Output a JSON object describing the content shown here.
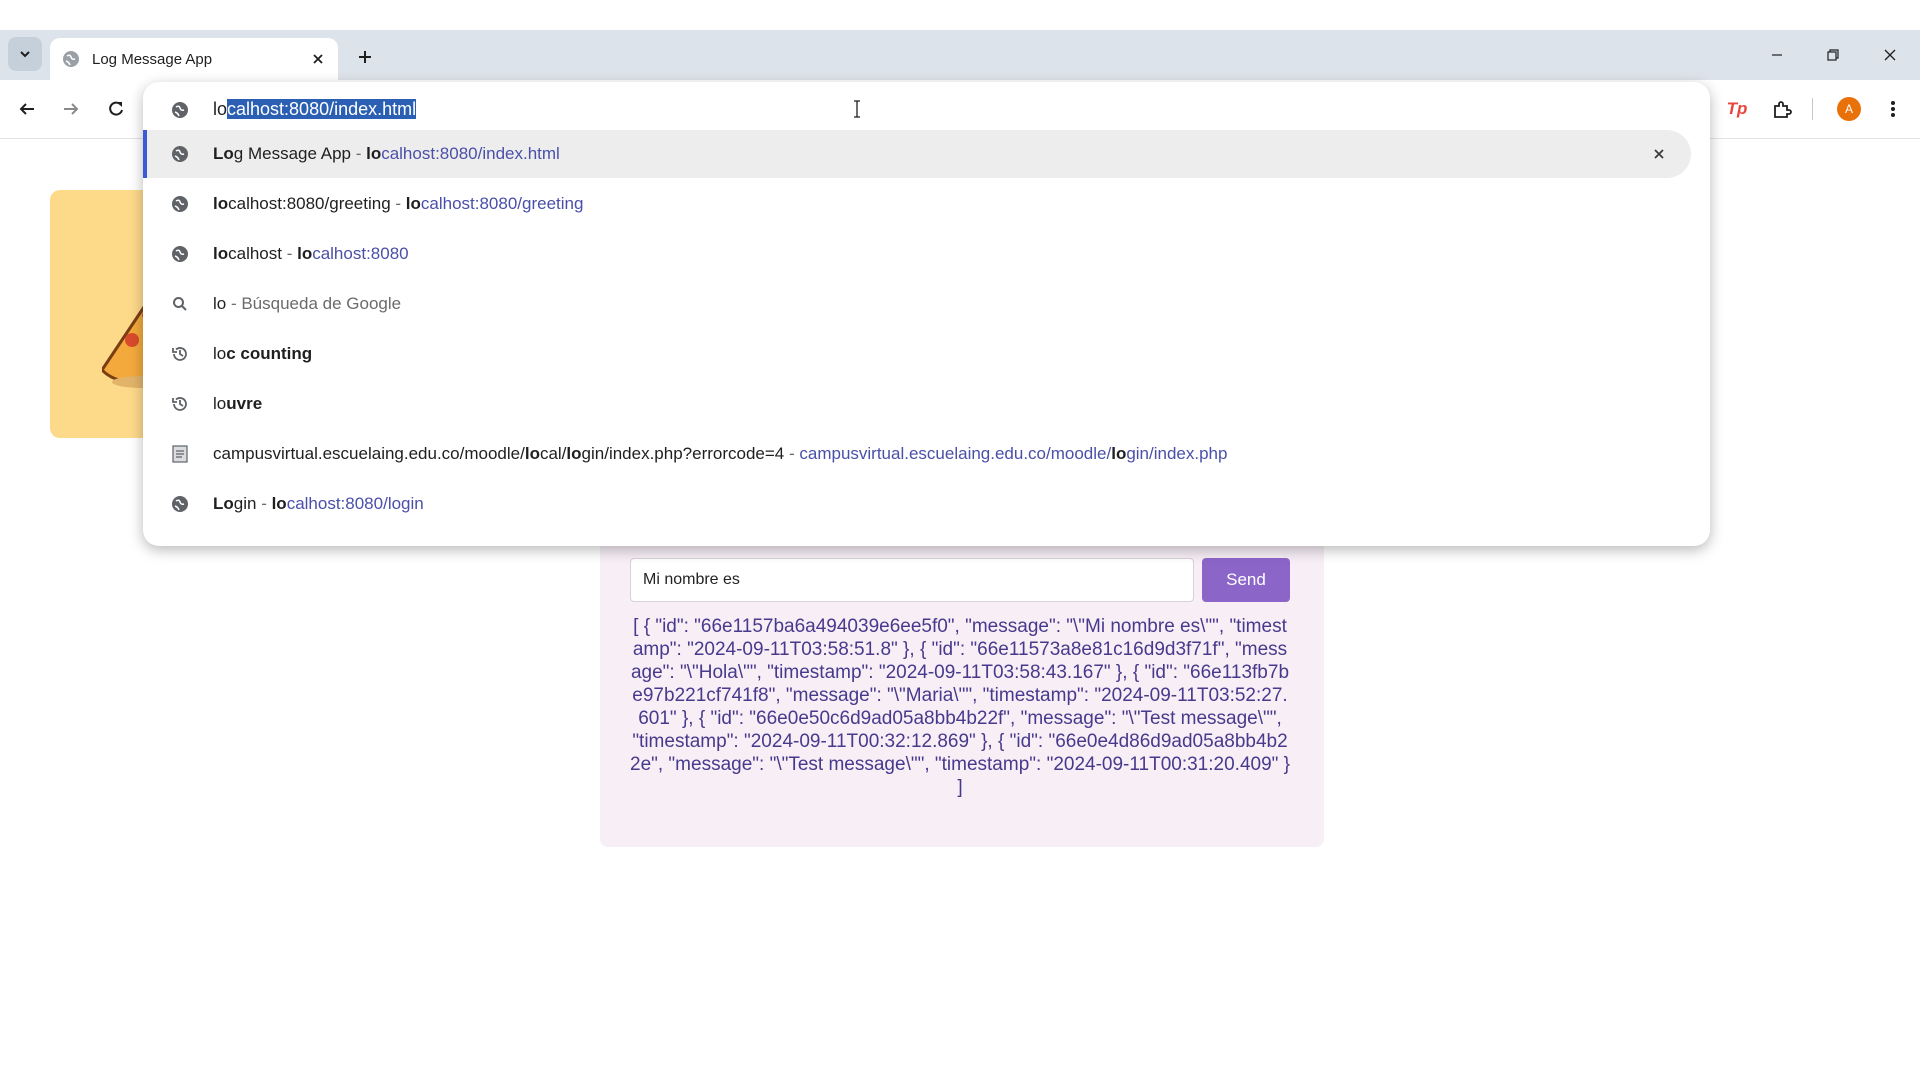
{
  "browser": {
    "tab": {
      "title": "Log Message App"
    },
    "omnibox": {
      "typed": "lo",
      "autocomplete_selected": "calhost:8080/index.html"
    },
    "profile_initial": "A",
    "extension_label": "Tp"
  },
  "suggestions": [
    {
      "icon": "globe-icon",
      "parts": [
        {
          "t": "Lo",
          "b": true
        },
        {
          "t": "g Message App",
          "b": false
        }
      ],
      "sep": " - ",
      "url_parts": [
        {
          "t": "lo",
          "b": true
        },
        {
          "t": "calhost:8080/index.html",
          "b": false
        }
      ],
      "active": true
    },
    {
      "icon": "globe-icon",
      "parts": [
        {
          "t": "lo",
          "b": true
        },
        {
          "t": "calhost:8080/greeting",
          "b": false
        }
      ],
      "sep": " - ",
      "url_parts": [
        {
          "t": "lo",
          "b": true
        },
        {
          "t": "calhost:8080/greeting",
          "b": false
        }
      ]
    },
    {
      "icon": "globe-icon",
      "parts": [
        {
          "t": "lo",
          "b": true
        },
        {
          "t": "calhost",
          "b": false
        }
      ],
      "sep": " - ",
      "url_parts": [
        {
          "t": "lo",
          "b": true
        },
        {
          "t": "calhost:8080",
          "b": false
        }
      ]
    },
    {
      "icon": "search-icon",
      "parts": [
        {
          "t": "lo",
          "b": false
        }
      ],
      "sep": " - ",
      "desc": "Búsqueda de Google"
    },
    {
      "icon": "history-icon",
      "parts": [
        {
          "t": "lo",
          "b": false
        },
        {
          "t": "c counting",
          "b": true
        }
      ]
    },
    {
      "icon": "history-icon",
      "parts": [
        {
          "t": "lo",
          "b": false
        },
        {
          "t": "uvre",
          "b": true
        }
      ]
    },
    {
      "icon": "document-icon",
      "parts": [
        {
          "t": "campusvirtual.escuelaing.edu.co/moodle/",
          "b": false
        },
        {
          "t": "lo",
          "b": true
        },
        {
          "t": "cal/",
          "b": false
        },
        {
          "t": "lo",
          "b": true
        },
        {
          "t": "gin/index.php?errorcode=4",
          "b": false
        }
      ],
      "sep": " - ",
      "url_parts": [
        {
          "t": "campusvirtual.escuelaing.edu.co/moodle/",
          "b": false
        },
        {
          "t": "lo",
          "b": true
        },
        {
          "t": "gin/index.php",
          "b": false
        }
      ]
    },
    {
      "icon": "globe-icon",
      "parts": [
        {
          "t": "Lo",
          "b": true
        },
        {
          "t": "gin",
          "b": false
        }
      ],
      "sep": " - ",
      "url_parts": [
        {
          "t": "lo",
          "b": true
        },
        {
          "t": "calhost:8080/login",
          "b": false
        }
      ]
    }
  ],
  "page": {
    "input_value": "Mi nombre es",
    "send_label": "Send",
    "output": "[ { \"id\": \"66e1157ba6a494039e6ee5f0\", \"message\": \"\\\"Mi nombre es\\\"\", \"timestamp\": \"2024-09-11T03:58:51.8\" }, { \"id\": \"66e11573a8e81c16d9d3f71f\", \"message\": \"\\\"Hola\\\"\", \"timestamp\": \"2024-09-11T03:58:43.167\" }, { \"id\": \"66e113fb7be97b221cf741f8\", \"message\": \"\\\"Maria\\\"\", \"timestamp\": \"2024-09-11T03:52:27.601\" }, { \"id\": \"66e0e50c6d9ad05a8bb4b22f\", \"message\": \"\\\"Test message\\\"\", \"timestamp\": \"2024-09-11T00:32:12.869\" }, { \"id\": \"66e0e4d86d9ad05a8bb4b22e\", \"message\": \"\\\"Test message\\\"\", \"timestamp\": \"2024-09-11T00:31:20.409\" } ]"
  },
  "colors": {
    "accent": "#8c65c9",
    "output_text": "#473a8c",
    "card_bg": "#f7eef6",
    "left_card_bg": "#fdd98a",
    "url_text": "#4a4fa8",
    "selection": "#2b5fb3",
    "avatar": "#e8710a"
  }
}
